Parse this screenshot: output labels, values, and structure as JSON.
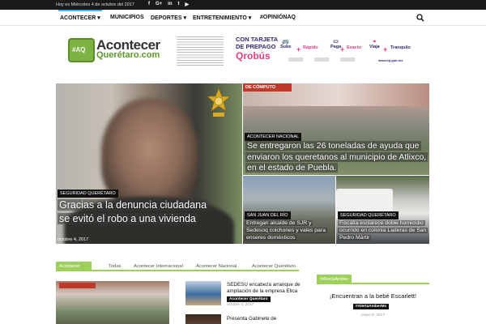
{
  "topbar": {
    "date": "Hoy es Miércoles 4 de octubre del 2017",
    "social": [
      "f",
      "G+",
      "in",
      "t",
      "▶"
    ]
  },
  "nav": {
    "items": [
      "ACONTECER",
      "MUNICIPIOS",
      "DEPORTES",
      "ENTRETENIMIENTO",
      "#OPINIÓNAQ"
    ]
  },
  "header": {
    "logo_badge": "#AQ",
    "logo_line1": "Acontecer",
    "logo_line2": "Querétaro.com",
    "ad": {
      "line1": "CON TARJETA",
      "line2": "DE PREPAGO",
      "brand": "Qrobús",
      "features": [
        {
          "label": "Sube",
          "accent": "Rápido"
        },
        {
          "label": "Paga",
          "accent": "Exacto"
        },
        {
          "label": "Viaja",
          "accent": "Tranquilo"
        }
      ],
      "url": "www.iqt.gob.mx"
    }
  },
  "featured": {
    "big": {
      "category": "SEGURIDAD QUERÉTARO",
      "title": "Gracias a la denuncia ciudadana se evitó el robo a una vivienda",
      "date": "octubre 4, 2017"
    },
    "top_right": {
      "sign": "DE CÓMPUTO",
      "category": "ACONTECER NACIONAL",
      "title": "Se entregaron las 26 toneladas de ayuda que enviaron los queretanos al municipio de Atlixco, en el estado de Puebla."
    },
    "bottom_left": {
      "category": "SAN JUAN DEL RÍO",
      "title": "Entregan alcalde de SJR y Sedesoq colchones y vales para enseres domésticos"
    },
    "bottom_right": {
      "category": "SEGURIDAD QUERÉTARO",
      "title": "Fiscalía esclarece doble homicidio ocurrido en colonia Laderas de San Pedro Mártir"
    }
  },
  "tabs": {
    "active": "Acontecer",
    "items": [
      "Todas",
      "Acontecer Internacional",
      "Acontecer Nacional",
      "Acontecer Querétaro"
    ]
  },
  "news_list": [
    {
      "title": "SEDESU encabeza arranque de ampliación de la empresa Elica",
      "tag": "Acontecer Querétaro",
      "date": "octubre 4, 2017"
    },
    {
      "title": "Presenta Gabinete de"
    }
  ],
  "sidebar": {
    "heading": "#AlertaAmber",
    "title": "¡Encuentran a la bebé Escarlett!",
    "tag": "#AlertaAmberMx",
    "date": "mayo 8, 2017"
  },
  "colors": {
    "accent_green": "#9cd05b",
    "nav_accent_blue": "#4db2ec",
    "topbar": "#1a1a1a"
  }
}
